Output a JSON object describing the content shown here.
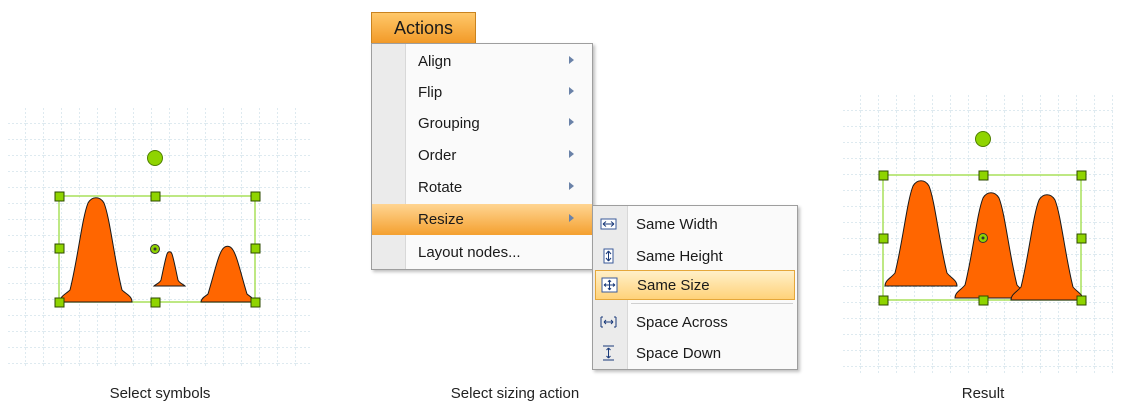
{
  "panels": {
    "left_caption": "Select symbols",
    "middle_caption": "Select sizing action",
    "right_caption": "Result"
  },
  "menu": {
    "title": "Actions",
    "items": [
      {
        "label": "Align"
      },
      {
        "label": "Flip"
      },
      {
        "label": "Grouping"
      },
      {
        "label": "Order"
      },
      {
        "label": "Rotate"
      },
      {
        "label": "Resize"
      },
      {
        "label": "Layout nodes..."
      }
    ]
  },
  "submenu": {
    "items": [
      {
        "label": "Same Width",
        "icon": "same-width-icon"
      },
      {
        "label": "Same Height",
        "icon": "same-height-icon"
      },
      {
        "label": "Same Size",
        "icon": "same-size-icon"
      },
      {
        "label": "Space Across",
        "icon": "space-across-icon"
      },
      {
        "label": "Space Down",
        "icon": "space-down-icon"
      }
    ]
  },
  "colors": {
    "cone": "#ff6600",
    "handle": "#8fd400",
    "selection": "#a8e05a",
    "grid": "#c3dbe6",
    "menu_highlight": "#f4a02f"
  }
}
